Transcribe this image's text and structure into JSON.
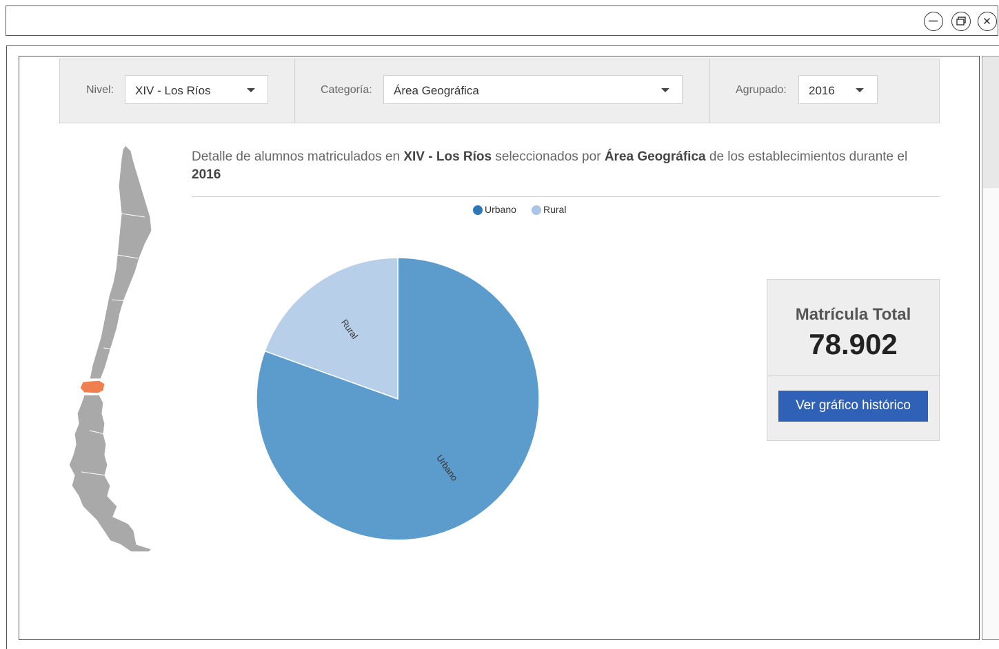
{
  "window": {
    "controls": [
      {
        "name": "minimize-icon"
      },
      {
        "name": "restore-icon"
      },
      {
        "name": "close-icon"
      }
    ]
  },
  "filters": {
    "nivel": {
      "label": "Nivel:",
      "value": "XIV - Los Ríos"
    },
    "categoria": {
      "label": "Categoría:",
      "value": "Área Geográfica"
    },
    "agrupado": {
      "label": "Agrupado:",
      "value": "2016"
    }
  },
  "description": {
    "part1": "Detalle de alumnos matriculados en ",
    "region": "XIV - Los Ríos",
    "part2": " seleccionados por ",
    "category": "Área Geográfica",
    "part3": " de los establecimientos durante el ",
    "year": "2016"
  },
  "map": {
    "highlight_color": "#f07f4f",
    "base_color": "#a9a9a9",
    "highlighted_region": "XIV - Los Ríos"
  },
  "chart_data": {
    "type": "pie",
    "categories": [
      "Urbano",
      "Rural"
    ],
    "values": [
      80.5,
      19.5
    ],
    "unit": "%",
    "colors": [
      "#5b9ccd",
      "#b8cfe9"
    ],
    "legend_colors": [
      "#2f78b8",
      "#a9c6e6"
    ],
    "legend": [
      "Urbano",
      "Rural"
    ],
    "legend_position": "top-center",
    "slice_labels": [
      "Urbano",
      "Rural"
    ]
  },
  "total": {
    "title": "Matrícula Total",
    "value": "78.902",
    "button_label": "Ver gráfico histórico"
  }
}
